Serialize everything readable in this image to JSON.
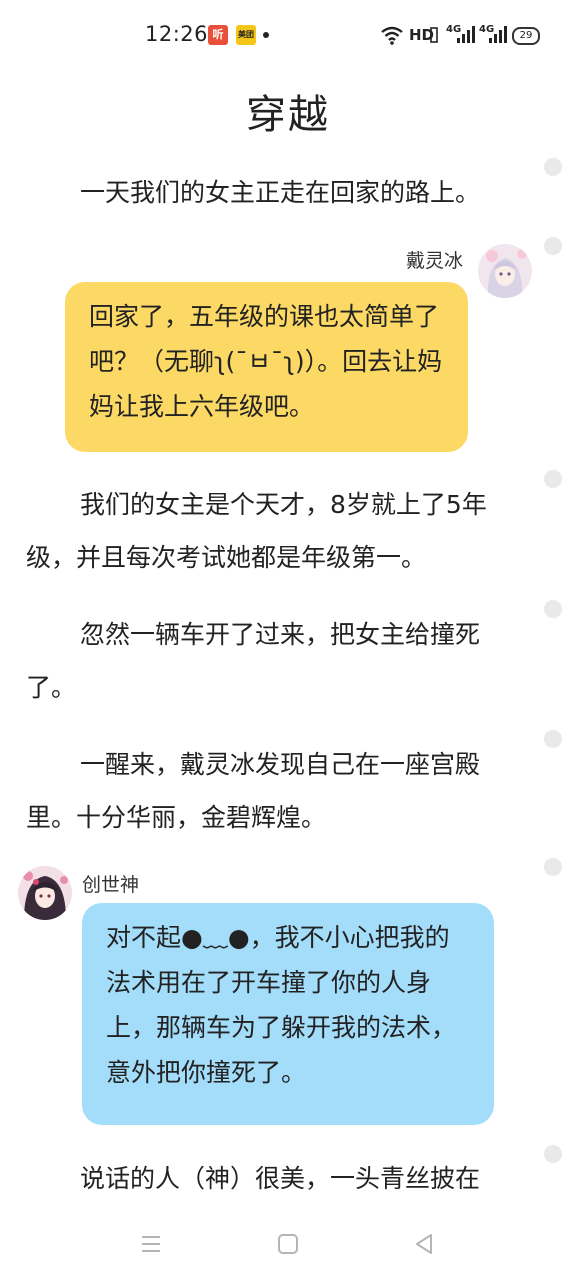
{
  "status_bar": {
    "time": "12:26",
    "apps": [
      {
        "name": "ting-app",
        "label": "听",
        "color": "#e8503b"
      },
      {
        "name": "meituan-app",
        "label": "美团",
        "color": "#f5c518"
      }
    ],
    "hd_label": "HD",
    "network1": "4G",
    "network2": "4G",
    "battery": "29"
  },
  "story": {
    "title": "穿越",
    "paragraphs": [
      "一天我们的女主正走在回家的路上。",
      "我们的女主是个天才，8岁就上了5年级，并且每次考试她都是年级第一。",
      "忽然一辆车开了过来，把女主给撞死了。",
      "一醒来，戴灵冰发现自己在一座宫殿里。十分华丽，金碧辉煌。",
      "说话的人（神）很美，一头青丝披在"
    ],
    "dialogues": [
      {
        "speaker": "戴灵冰",
        "side": "right",
        "text": "回家了，五年级的课也太简单了吧？（无聊ʅ(¯ㅂ¯ʅ)）。回去让妈妈让我上六年级吧。",
        "color": "#fbd964"
      },
      {
        "speaker": "创世神",
        "side": "left",
        "text": "对不起●﹏●，我不小心把我的法术用在了开车撞了你的人身上，那辆车为了躲开我的法术，意外把你撞死了。",
        "color": "#a4ddfa"
      }
    ]
  }
}
